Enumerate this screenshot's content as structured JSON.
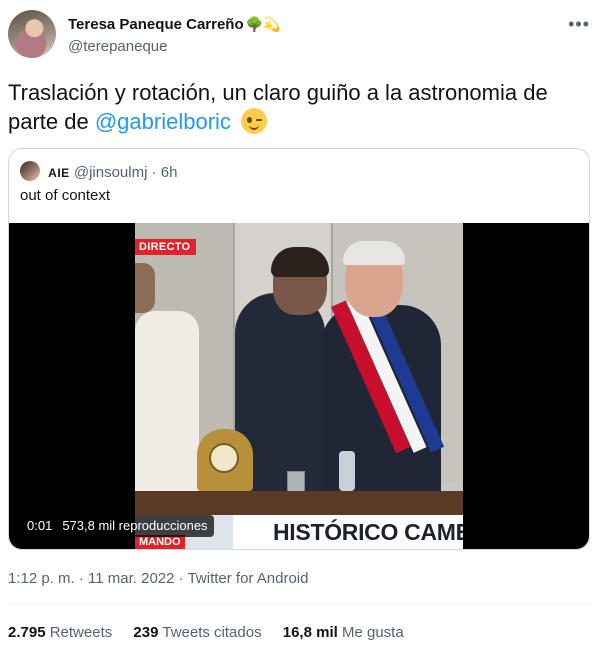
{
  "author": {
    "name": "Teresa Paneque Carreño",
    "name_emoji": "🌳💫",
    "handle": "@terepaneque"
  },
  "more_icon": "more-options-icon",
  "tweet": {
    "text_before": "Traslación y rotación, un claro guiño a la astronomia de parte de ",
    "mention": "@gabrielboric",
    "emoji": "wink-emoji"
  },
  "quoted": {
    "name": "AIE",
    "handle": "@jinsoulmj",
    "dot": "·",
    "time": "6h",
    "text": "out of context",
    "video": {
      "overlay_live": "DIRECTO",
      "ticker_text": "HISTÓRICO CAMBI",
      "ticker_sub": "MANDO",
      "duration": "0:01",
      "views": "573,8 mil reproducciones"
    }
  },
  "meta": {
    "time": "1:12 p. m.",
    "sep1": "·",
    "date": "11 mar. 2022",
    "sep2": "·",
    "source": "Twitter for Android"
  },
  "stats": {
    "retweets_count": "2.795",
    "retweets_label": "Retweets",
    "quotes_count": "239",
    "quotes_label": "Tweets citados",
    "likes_count": "16,8 mil",
    "likes_label": "Me gusta"
  },
  "colors": {
    "link": "#1d9bf0",
    "secondary_text": "#536471",
    "border": "#cfd9de"
  }
}
